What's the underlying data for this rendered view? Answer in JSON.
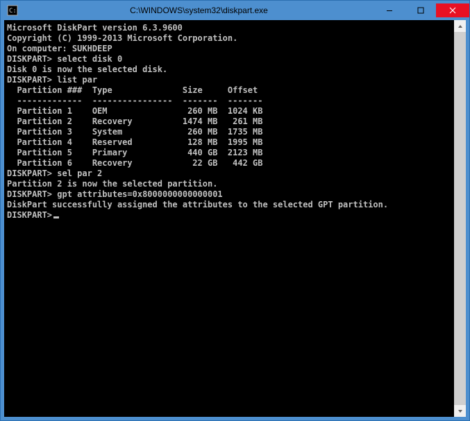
{
  "window": {
    "title": "C:\\WINDOWS\\system32\\diskpart.exe"
  },
  "console": {
    "header_version": "Microsoft DiskPart version 6.3.9600",
    "blank": "",
    "copyright": "Copyright (C) 1999-2013 Microsoft Corporation.",
    "on_computer": "On computer: SUKHDEEP",
    "prompt1": "DISKPART> select disk 0",
    "resp1": "Disk 0 is now the selected disk.",
    "prompt2": "DISKPART> list par",
    "table_header": "  Partition ###  Type              Size     Offset",
    "table_sep": "  -------------  ----------------  -------  -------",
    "table_rows": [
      "  Partition 1    OEM                260 MB  1024 KB",
      "  Partition 2    Recovery          1474 MB   261 MB",
      "  Partition 3    System             260 MB  1735 MB",
      "  Partition 4    Reserved           128 MB  1995 MB",
      "  Partition 5    Primary            440 GB  2123 MB",
      "  Partition 6    Recovery            22 GB   442 GB"
    ],
    "prompt3": "DISKPART> sel par 2",
    "resp3": "Partition 2 is now the selected partition.",
    "prompt4": "DISKPART> gpt attributes=0x8000000000000001",
    "resp4": "DiskPart successfully assigned the attributes to the selected GPT partition.",
    "prompt5": "DISKPART>"
  }
}
